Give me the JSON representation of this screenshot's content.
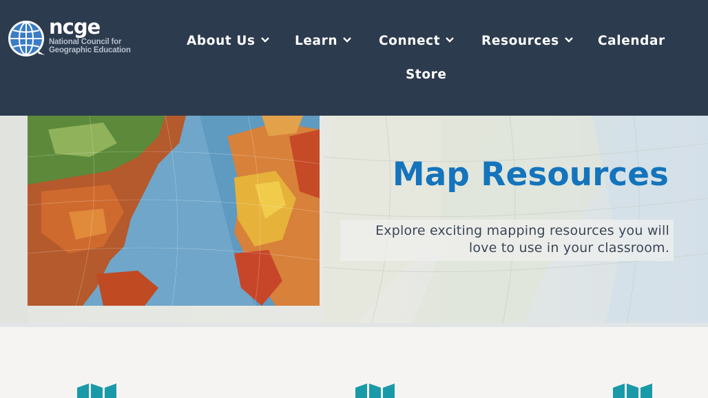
{
  "site": {
    "logo_text": "ncge",
    "logo_subtitle_line1": "National Council for",
    "logo_subtitle_line2": "Geographic Education"
  },
  "nav": {
    "items": [
      {
        "label": "About Us",
        "has_dropdown": true
      },
      {
        "label": "Learn",
        "has_dropdown": true
      },
      {
        "label": "Connect",
        "has_dropdown": true
      },
      {
        "label": "Resources",
        "has_dropdown": true
      },
      {
        "label": "Calendar",
        "has_dropdown": false
      },
      {
        "label": "Store",
        "has_dropdown": false
      }
    ]
  },
  "hero": {
    "title": "Map Resources",
    "subtitle_line1": "Explore exciting mapping resources you will",
    "subtitle_line2": "love to use in your classroom."
  },
  "resource_icons": [
    "map-icon",
    "map-icon",
    "map-icon"
  ],
  "colors": {
    "header_bg": "#2d3b4e",
    "title_blue": "#1474bc",
    "icon_teal": "#1a9aa8",
    "page_bg": "#f5f4f2"
  }
}
